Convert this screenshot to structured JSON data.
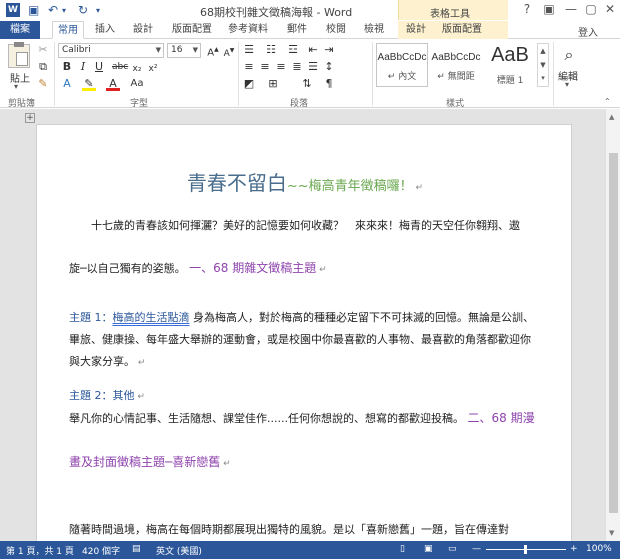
{
  "titlebar": {
    "title": "68期校刊雜文徵稿海報 - Word",
    "tools_label": "表格工具",
    "qa_icons": [
      "word-logo-icon",
      "save-icon",
      "undo-icon",
      "redo-icon",
      "customize-qat-icon"
    ],
    "window_controls": [
      "?",
      "▣",
      "—",
      "▢",
      "✕"
    ]
  },
  "tabs": {
    "file": "檔案",
    "home": "常用",
    "insert": "插入",
    "design": "設計",
    "layout": "版面配置",
    "references": "參考資料",
    "mailings": "郵件",
    "review": "校閱",
    "view": "檢視",
    "table_design": "設計",
    "table_layout": "版面配置",
    "login": "登入"
  },
  "ribbon": {
    "clipboard": {
      "paste": "貼上",
      "label": "剪貼簿"
    },
    "font": {
      "name": "Calibri",
      "size": "16",
      "label": "字型"
    },
    "paragraph": {
      "label": "段落"
    },
    "styles": {
      "label": "樣式",
      "items": [
        {
          "sample": "AaBbCcDc",
          "name": "↵ 內文"
        },
        {
          "sample": "AaBbCcDc",
          "name": "↵ 無間距"
        },
        {
          "sample": "AaB",
          "name": "標題 1"
        }
      ]
    },
    "editing": {
      "label": "編輯"
    }
  },
  "document": {
    "title_main": "青春不留白",
    "title_sub": "~~梅高青年徵稿囉！",
    "p1_line1": "十七歲的青春該如何揮灑？美好的記憶要如何收藏？　來來來！梅青的天空任你翱翔、遨",
    "p1_line2a": "旋─以自己獨有的姿態。",
    "p1_line2b": "一、68 期雜文徵稿主題",
    "t1_label": "主題 1：",
    "t1_title": "梅高的生活點滴",
    "t1_rest": "身為梅高人，對於梅高的種種必定留下不可抹滅的回憶。無論是公訓、",
    "t1_line2": "畢旅、健康操、每年盛大舉辦的運動會，或是校園中你最喜歡的人事物、最喜歡的角落都歡迎你",
    "t1_line3": "與大家分享。",
    "t2_label": "主題 2：其他",
    "t2_line1a": "舉凡你的心情記事、生活隨想、課堂佳作......任何你想說的、想寫的都歡迎投稿。",
    "t2_line1b": "二、68 期漫",
    "t2_line2": "畫及封面徵稿主題─喜新戀舊",
    "p_last": "隨著時間過境，梅高在每個時期都展現出獨特的風貌。是以「喜新戀舊」一題，旨在傳達對"
  },
  "statusbar": {
    "page": "第 1 頁，共 1 頁",
    "words": "420 個字",
    "language": "英文 (美國)",
    "zoom": "100%"
  },
  "colors": {
    "accent": "#2b579a",
    "title": "#4a6d8c",
    "subtitle": "#6aa84f",
    "heading": "#8e44ad",
    "tools_band": "#fdf1cf"
  }
}
